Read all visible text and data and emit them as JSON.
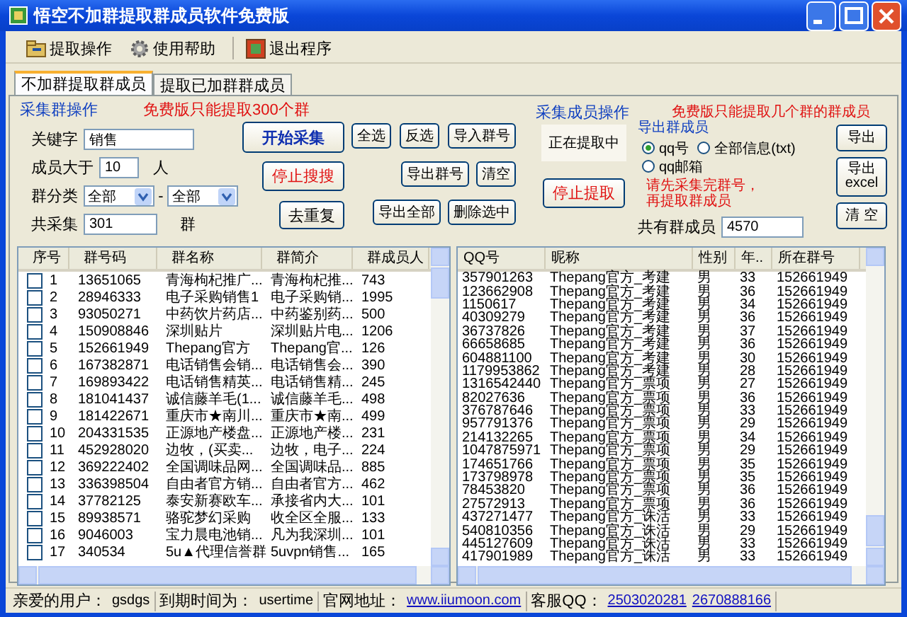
{
  "window": {
    "title": "悟空不加群提取群成员软件免费版"
  },
  "toolbar": [
    {
      "kind": "extract",
      "label": "提取操作"
    },
    {
      "kind": "help",
      "label": "使用帮助"
    },
    {
      "kind": "exit",
      "label": "退出程序"
    }
  ],
  "tabs": [
    {
      "label": "不加群提取群成员",
      "selected": true
    },
    {
      "label": "提取已加群群成员",
      "selected": false
    }
  ],
  "group_panel": {
    "title": "采集群操作",
    "notice": "免费版只能提取300个群",
    "keyword": {
      "label": "关键字",
      "value": "销售"
    },
    "min_members": {
      "label": "成员大于",
      "value": "10",
      "unit": "人"
    },
    "category": {
      "label": "群分类",
      "from": "全部",
      "separator": "-",
      "to": "全部"
    },
    "total": {
      "label": "共采集",
      "value": "301",
      "unit": "群"
    },
    "main_buttons": [
      {
        "kind": "start",
        "label": "开始采集"
      },
      {
        "kind": "stop",
        "label": "停止搜搜"
      },
      {
        "kind": "plain",
        "label": "去重复"
      }
    ],
    "tool_button_rows": [
      {
        "buttons": [
          "全选",
          "反选",
          "导入群号"
        ]
      },
      {
        "buttons": [
          "导出群号",
          "清空"
        ]
      },
      {
        "buttons": [
          "导出全部",
          "删除选中"
        ]
      }
    ]
  },
  "member_panel": {
    "title": "采集成员操作",
    "notice": "免费版只能提取几个群的群成员",
    "status": "正在提取中",
    "stop_button": "停止提取",
    "export": {
      "title": "导出群成员",
      "options": [
        {
          "label": "qq号",
          "selected": true
        },
        {
          "label": "全部信息(txt)",
          "selected": false
        },
        {
          "label": "qq邮箱",
          "selected": false
        }
      ]
    },
    "hint": [
      "请先采集完群号，",
      "再提取群成员"
    ],
    "total": {
      "label": "共有群成员",
      "value": "4570"
    },
    "buttons": [
      {
        "lines": [
          "导出"
        ]
      },
      {
        "lines": [
          "导出",
          "excel"
        ]
      },
      {
        "lines": [
          "清 空"
        ]
      }
    ]
  },
  "group_table": {
    "columns": [
      "序号",
      "群号码",
      "群名称",
      "群简介",
      "群成员人"
    ],
    "rows": [
      {
        "checked": false,
        "cells": [
          "1",
          "13651065",
          "青海枸杞推广...",
          "青海枸杞推...",
          "743"
        ]
      },
      {
        "checked": false,
        "cells": [
          "2",
          "28946333",
          "电子采购销售1",
          "电子采购销...",
          "1995"
        ]
      },
      {
        "checked": false,
        "cells": [
          "3",
          "93050271",
          "中药饮片药店...",
          "中药鉴别药...",
          "500"
        ]
      },
      {
        "checked": false,
        "cells": [
          "4",
          "150908846",
          "深圳贴片",
          "深圳贴片电...",
          "1206"
        ]
      },
      {
        "checked": false,
        "cells": [
          "5",
          "152661949",
          "Thepang官方",
          "Thepang官...",
          "126"
        ]
      },
      {
        "checked": false,
        "cells": [
          "6",
          "167382871",
          "电话销售会销...",
          "电话销售会...",
          "390"
        ]
      },
      {
        "checked": false,
        "cells": [
          "7",
          "169893422",
          "电话销售精英...",
          "电话销售精...",
          "245"
        ]
      },
      {
        "checked": false,
        "cells": [
          "8",
          "181041437",
          "诚信藤羊毛(1...",
          "诚信藤羊毛...",
          "498"
        ]
      },
      {
        "checked": false,
        "cells": [
          "9",
          "181422671",
          "重庆市★南川...",
          "重庆市★南...",
          "499"
        ]
      },
      {
        "checked": false,
        "cells": [
          "10",
          "204331535",
          "正源地产楼盘...",
          "正源地产楼...",
          "231"
        ]
      },
      {
        "checked": false,
        "cells": [
          "11",
          "452928020",
          "边牧，(买卖...",
          "边牧，电子...",
          "224"
        ]
      },
      {
        "checked": false,
        "cells": [
          "12",
          "369222402",
          "全国调味品网...",
          "全国调味品...",
          "885"
        ]
      },
      {
        "checked": false,
        "cells": [
          "13",
          "336398504",
          "自由者官方销...",
          "自由者官方...",
          "462"
        ]
      },
      {
        "checked": false,
        "cells": [
          "14",
          "37782125",
          "泰安新赛欧车...",
          "承接省内大...",
          "101"
        ]
      },
      {
        "checked": false,
        "cells": [
          "15",
          "89938571",
          "骆驼梦幻采购",
          "收全区全服...",
          "133"
        ]
      },
      {
        "checked": false,
        "cells": [
          "16",
          "9046003",
          "宝力晨电池销...",
          "凡为我深圳...",
          "101"
        ]
      },
      {
        "checked": false,
        "cells": [
          "17",
          "340534",
          "5u▲代理信誉群",
          "5uvpn销售...",
          "165"
        ]
      }
    ]
  },
  "member_table": {
    "columns": [
      "QQ号",
      "昵称",
      "性别",
      "年..",
      "所在群号"
    ],
    "rows": [
      [
        "357901263",
        "Thepang官方_考建",
        "男",
        "33",
        "152661949"
      ],
      [
        "123662908",
        "Thepang官方_考建",
        "男",
        "36",
        "152661949"
      ],
      [
        "1150617",
        "Thepang官方_考建",
        "男",
        "34",
        "152661949"
      ],
      [
        "40309279",
        "Thepang官方_考建",
        "男",
        "36",
        "152661949"
      ],
      [
        "36737826",
        "Thepang官方_考建",
        "男",
        "37",
        "152661949"
      ],
      [
        "66658685",
        "Thepang官方_考建",
        "男",
        "36",
        "152661949"
      ],
      [
        "604881100",
        "Thepang官方_考建",
        "男",
        "30",
        "152661949"
      ],
      [
        "1179953862",
        "Thepang官方_考建",
        "男",
        "28",
        "152661949"
      ],
      [
        "1316542440",
        "Thepang官方_票项",
        "男",
        "27",
        "152661949"
      ],
      [
        "82027636",
        "Thepang官方_票项",
        "男",
        "36",
        "152661949"
      ],
      [
        "376787646",
        "Thepang官方_票项",
        "男",
        "33",
        "152661949"
      ],
      [
        "957791376",
        "Thepang官方_票项",
        "男",
        "29",
        "152661949"
      ],
      [
        "214132265",
        "Thepang官方_票项",
        "男",
        "34",
        "152661949"
      ],
      [
        "1047875971",
        "Thepang官方_票项",
        "男",
        "29",
        "152661949"
      ],
      [
        "174651766",
        "Thepang官方_票项",
        "男",
        "35",
        "152661949"
      ],
      [
        "173798978",
        "Thepang官方_票项",
        "男",
        "35",
        "152661949"
      ],
      [
        "78453820",
        "Thepang官方_票项",
        "男",
        "36",
        "152661949"
      ],
      [
        "27572913",
        "Thepang官方_票项",
        "男",
        "36",
        "152661949"
      ],
      [
        "437271477",
        "Thepang官方_诛活",
        "男",
        "33",
        "152661949"
      ],
      [
        "540810356",
        "Thepang官方_诛活",
        "男",
        "29",
        "152661949"
      ],
      [
        "445127609",
        "Thepang官方_诛活",
        "男",
        "33",
        "152661949"
      ],
      [
        "417901989",
        "Thepang官方_诛活",
        "男",
        "33",
        "152661949"
      ]
    ]
  },
  "status_bar": [
    {
      "label": "亲爱的用户：",
      "value": "gsdgs"
    },
    {
      "label": "到期时间为：",
      "value": "usertime"
    },
    {
      "label": "官网地址：",
      "links": [
        "www.iiumoon.com"
      ]
    },
    {
      "label": "客服QQ：",
      "links": [
        "2503020281",
        "2670888166"
      ]
    }
  ]
}
